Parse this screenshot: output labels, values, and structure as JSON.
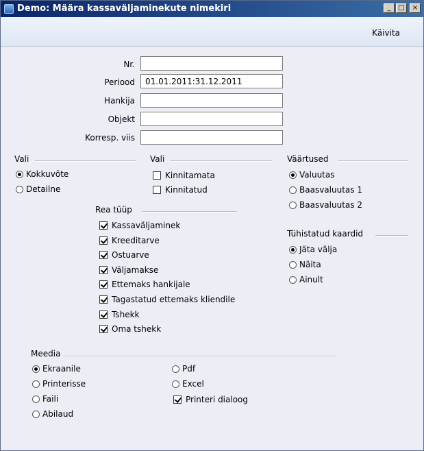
{
  "window": {
    "title": "Demo: Määra kassaväljaminekute nimekiri",
    "controls": [
      "_",
      "□",
      "×"
    ]
  },
  "toolbar": {
    "run_label": "Käivita"
  },
  "form": {
    "nr": {
      "label": "Nr.",
      "value": ""
    },
    "periood": {
      "label": "Periood",
      "value": "01.01.2011:31.12.2011"
    },
    "hankija": {
      "label": "Hankija",
      "value": ""
    },
    "objekt": {
      "label": "Objekt",
      "value": ""
    },
    "korresp": {
      "label": "Korresp. viis",
      "value": ""
    }
  },
  "vali1": {
    "title": "Vali",
    "options": [
      {
        "label": "Kokkuvõte",
        "selected": true
      },
      {
        "label": "Detailne",
        "selected": false
      }
    ]
  },
  "vali2": {
    "title": "Vali",
    "options": [
      {
        "label": "Kinnitamata",
        "checked": false
      },
      {
        "label": "Kinnitatud",
        "checked": false
      }
    ]
  },
  "vaartused": {
    "title": "Väärtused",
    "options": [
      {
        "label": "Valuutas",
        "selected": true
      },
      {
        "label": "Baasvaluutas 1",
        "selected": false
      },
      {
        "label": "Baasvaluutas 2",
        "selected": false
      }
    ]
  },
  "rea_tyyp": {
    "title": "Rea tüüp",
    "options": [
      {
        "label": "Kassaväljaminek",
        "checked": true
      },
      {
        "label": "Kreeditarve",
        "checked": true
      },
      {
        "label": "Ostuarve",
        "checked": true
      },
      {
        "label": "Väljamakse",
        "checked": true
      },
      {
        "label": "Ettemaks hankijale",
        "checked": true
      },
      {
        "label": "Tagastatud ettemaks kliendile",
        "checked": true
      },
      {
        "label": "Tshekk",
        "checked": true
      },
      {
        "label": "Oma tshekk",
        "checked": true
      }
    ]
  },
  "tyhistatud": {
    "title": "Tühistatud kaardid",
    "options": [
      {
        "label": "Jäta välja",
        "selected": true
      },
      {
        "label": "Näita",
        "selected": false
      },
      {
        "label": "Ainult",
        "selected": false
      }
    ]
  },
  "meedia": {
    "title": "Meedia",
    "col1": [
      {
        "label": "Ekraanile",
        "selected": true
      },
      {
        "label": "Printerisse",
        "selected": false
      },
      {
        "label": "Faili",
        "selected": false
      },
      {
        "label": "Abilaud",
        "selected": false
      }
    ],
    "col2": [
      {
        "label": "Pdf",
        "selected": false
      },
      {
        "label": "Excel",
        "selected": false
      }
    ],
    "printer_dialog": {
      "label": "Printeri dialoog",
      "checked": true
    }
  }
}
